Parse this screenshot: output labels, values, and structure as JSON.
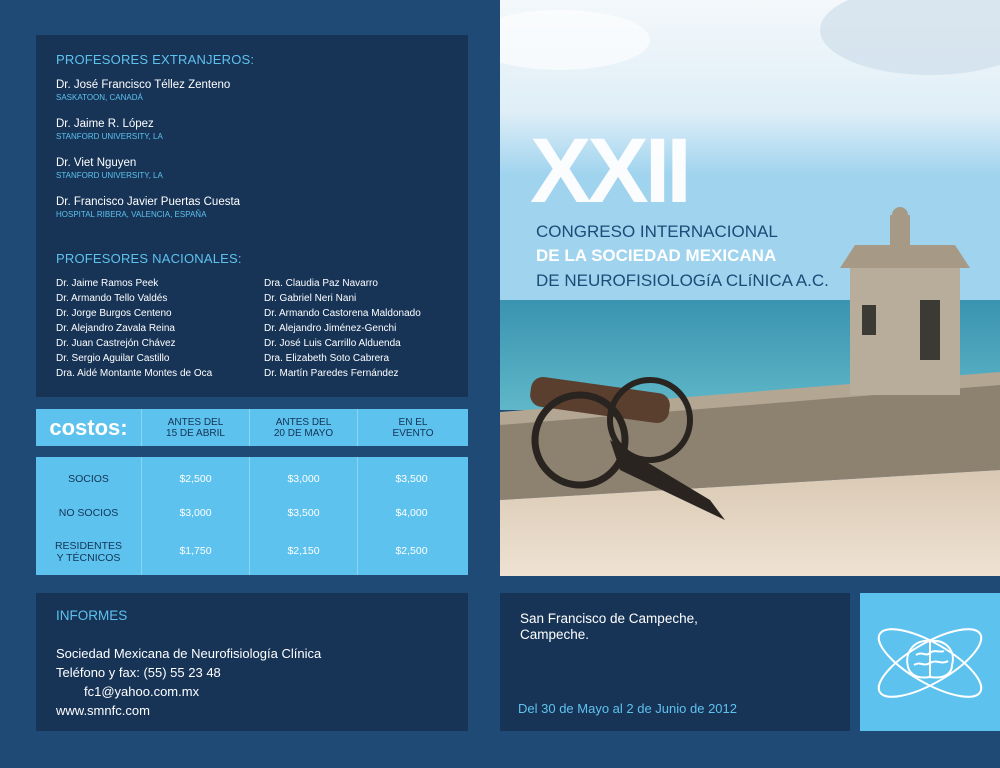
{
  "profesores_extranjeros": {
    "title": "PROFESORES EXTRANJEROS:",
    "items": [
      {
        "name": "Dr. José Francisco Téllez Zenteno",
        "place": "SASKATOON, CANADÁ"
      },
      {
        "name": "Dr. Jaime R. López",
        "place": "STANFORD UNIVERSITY, LA"
      },
      {
        "name": "Dr. Viet Nguyen",
        "place": "STANFORD UNIVERSITY, LA"
      },
      {
        "name": "Dr. Francisco Javier Puertas Cuesta",
        "place": "HOSPITAL RIBERA, VALENCIA, ESPAÑA"
      }
    ]
  },
  "profesores_nacionales": {
    "title": "PROFESORES NACIONALES:",
    "col1": [
      "Dr. Jaime Ramos Peek",
      "Dr. Armando Tello Valdés",
      "Dr. Jorge Burgos Centeno",
      "Dr. Alejandro Zavala Reina",
      "Dr. Juan Castrejón Chávez",
      "Dr. Sergio Aguilar Castillo",
      "Dra. Aidé Montante Montes de Oca"
    ],
    "col2": [
      "Dra. Claudia Paz Navarro",
      "Dr. Gabriel Neri Nani",
      "Dr. Armando Castorena Maldonado",
      "Dr. Alejandro Jiménez-Genchi",
      "Dr. José Luis Carrillo Alduenda",
      "Dra. Elizabeth Soto Cabrera",
      "Dr. Martín Paredes Fernández"
    ]
  },
  "costos": {
    "title": "costos:",
    "headers": [
      {
        "line1": "ANTES DEL",
        "line2": "15 DE ABRIL"
      },
      {
        "line1": "ANTES DEL",
        "line2": "20 DE MAYO"
      },
      {
        "line1": "EN EL",
        "line2": "EVENTO"
      }
    ],
    "rows": [
      {
        "label1": "SOCIOS",
        "label2": "",
        "prices": [
          "$2,500",
          "$3,000",
          "$3,500"
        ]
      },
      {
        "label1": "NO SOCIOS",
        "label2": "",
        "prices": [
          "$3,000",
          "$3,500",
          "$4,000"
        ]
      },
      {
        "label1": "RESIDENTES",
        "label2": "Y TÉCNICOS",
        "prices": [
          "$1,750",
          "$2,150",
          "$2,500"
        ]
      }
    ]
  },
  "informes": {
    "title": "INFORMES",
    "org": "Sociedad Mexicana de Neurofisiología Clínica",
    "phone": "Teléfono y fax: (55) 55 23 48",
    "email": "fc1@yahoo.com.mx",
    "web": "www.smnfc.com"
  },
  "congreso": {
    "roman": "XXII",
    "line1": "CONGRESO INTERNACIONAL",
    "line2": "DE LA SOCIEDAD MEXICANA",
    "line3": "DE NEUROFISIOLOGíA CLíNICA A.C."
  },
  "ubicacion": {
    "city": "San Francisco de Campeche,",
    "state": "Campeche.",
    "dates": "Del 30 de Mayo al 2 de Junio de 2012"
  },
  "colors": {
    "background": "#1e4a75",
    "panel": "#173457",
    "accent": "#5ec2ee",
    "text_dark": "#123456"
  },
  "icons": [
    "brain-atom-logo-icon"
  ]
}
